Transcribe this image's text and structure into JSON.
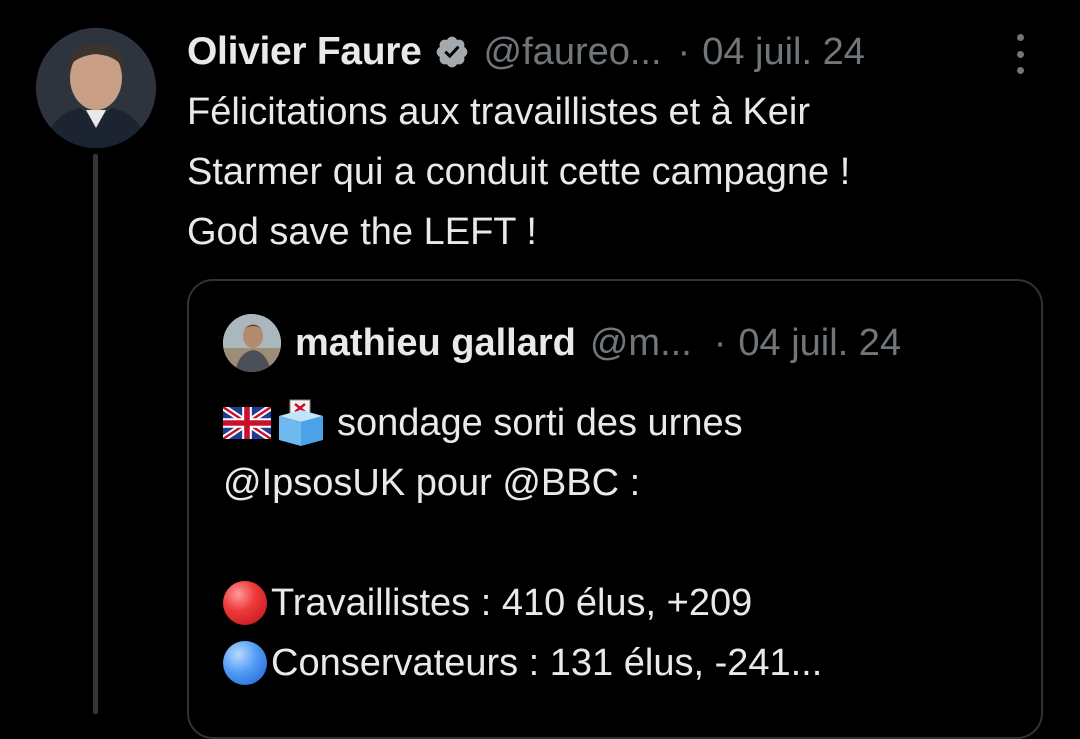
{
  "tweet": {
    "author_name": "Olivier Faure",
    "handle": "@faureo...",
    "separator": "·",
    "date": "04 juil. 24",
    "text_lines": [
      "Félicitations aux travaillistes et à Keir",
      "Starmer qui a conduit cette campagne !",
      "God save the LEFT !"
    ]
  },
  "quoted_tweet": {
    "author_name": "mathieu gallard",
    "handle": "@m...",
    "separator": "·",
    "date": "04 juil. 24",
    "line1_text": "sondage sorti des urnes",
    "line2_text": "@IpsosUK pour @BBC :",
    "result1_text": "Travaillistes : 410 élus, +209",
    "result2_text": "Conservateurs : 131 élus, -241..."
  },
  "icons": {
    "verified": "verified-badge-icon",
    "more": "more-options-icon",
    "flag": "uk-flag-emoji",
    "ballot": "ballot-box-emoji",
    "red_circle": "red-circle-emoji",
    "blue_circle": "blue-circle-emoji"
  },
  "colors": {
    "background": "#000000",
    "text": "#e7e9ea",
    "muted": "#71767b",
    "border": "#2f3336"
  }
}
